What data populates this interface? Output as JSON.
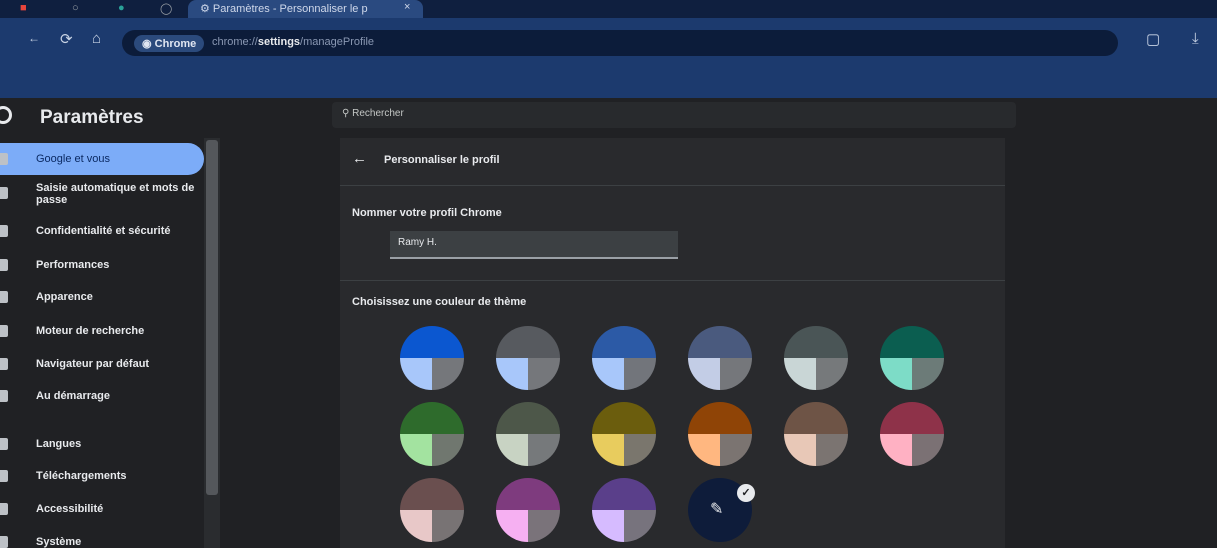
{
  "tabs": {
    "active_title": "Paramètres - Personnaliser le p",
    "close_glyph": "×"
  },
  "toolbar": {
    "back_glyph": "←",
    "reload_glyph": "⟳",
    "home_glyph": "⌂",
    "chip_label": "Chrome",
    "url_scheme": "chrome://",
    "url_host": "settings",
    "url_path": "/manageProfile",
    "star_glyph": "☆",
    "extensions_glyph": "▢",
    "download_glyph": "⤓"
  },
  "header": {
    "title": "Paramètres",
    "search_placeholder": "Rechercher"
  },
  "sidebar": {
    "items": [
      {
        "label": "Google et vous",
        "icon": "person-icon",
        "active": true
      },
      {
        "label": "Saisie automatique et mots de passe",
        "icon": "clipboard-icon"
      },
      {
        "label": "Confidentialité et sécurité",
        "icon": "shield-icon"
      },
      {
        "label": "Performances",
        "icon": "speedometer-icon"
      },
      {
        "label": "Apparence",
        "icon": "palette-icon"
      },
      {
        "label": "Moteur de recherche",
        "icon": "search-icon"
      },
      {
        "label": "Navigateur par défaut",
        "icon": "browser-icon"
      },
      {
        "label": "Au démarrage",
        "icon": "power-icon"
      },
      {
        "label": "Langues",
        "icon": "globe-icon"
      },
      {
        "label": "Téléchargements",
        "icon": "download-icon"
      },
      {
        "label": "Accessibilité",
        "icon": "accessibility-icon"
      },
      {
        "label": "Système",
        "icon": "wrench-icon"
      }
    ]
  },
  "main": {
    "back_glyph": "←",
    "page_title": "Personnaliser le profil",
    "name_section_label": "Nommer votre profil Chrome",
    "name_value": "Ramy H.",
    "theme_section_label": "Choisissez une couleur de thème",
    "swatches": [
      {
        "top": "#0b57d0",
        "bl": "#a8c7fa",
        "br": "#75777b"
      },
      {
        "top": "#575a5f",
        "bl": "#a8c7fa",
        "br": "#75777b"
      },
      {
        "top": "#2c5aa6",
        "bl": "#a8c7fa",
        "br": "#72757b"
      },
      {
        "top": "#4a5a7e",
        "bl": "#c3cde6",
        "br": "#75777b"
      },
      {
        "top": "#4a5556",
        "bl": "#c9d6d6",
        "br": "#76797b"
      },
      {
        "top": "#0b5e50",
        "bl": "#7ddcc7",
        "br": "#6c7b78"
      },
      {
        "top": "#2e6b2c",
        "bl": "#a3e3a0",
        "br": "#70776f"
      },
      {
        "top": "#4d5749",
        "bl": "#c8d3c3",
        "br": "#76797b"
      },
      {
        "top": "#6b5d0d",
        "bl": "#e8cc5e",
        "br": "#7a766d"
      },
      {
        "top": "#8f4406",
        "bl": "#ffb780",
        "br": "#7b7471"
      },
      {
        "top": "#6e5446",
        "bl": "#e8c8b7",
        "br": "#7b7471"
      },
      {
        "top": "#8e3249",
        "bl": "#ffb1c3",
        "br": "#7b7174"
      },
      {
        "top": "#6a4f4f",
        "bl": "#e8c8c8",
        "br": "#787374"
      },
      {
        "top": "#7e3b7e",
        "bl": "#f6b0f2",
        "br": "#7a737a"
      },
      {
        "top": "#5a3f8a",
        "bl": "#d6bbff",
        "br": "#77737d"
      }
    ],
    "custom_glyph": "✎",
    "check_glyph": "✓"
  }
}
